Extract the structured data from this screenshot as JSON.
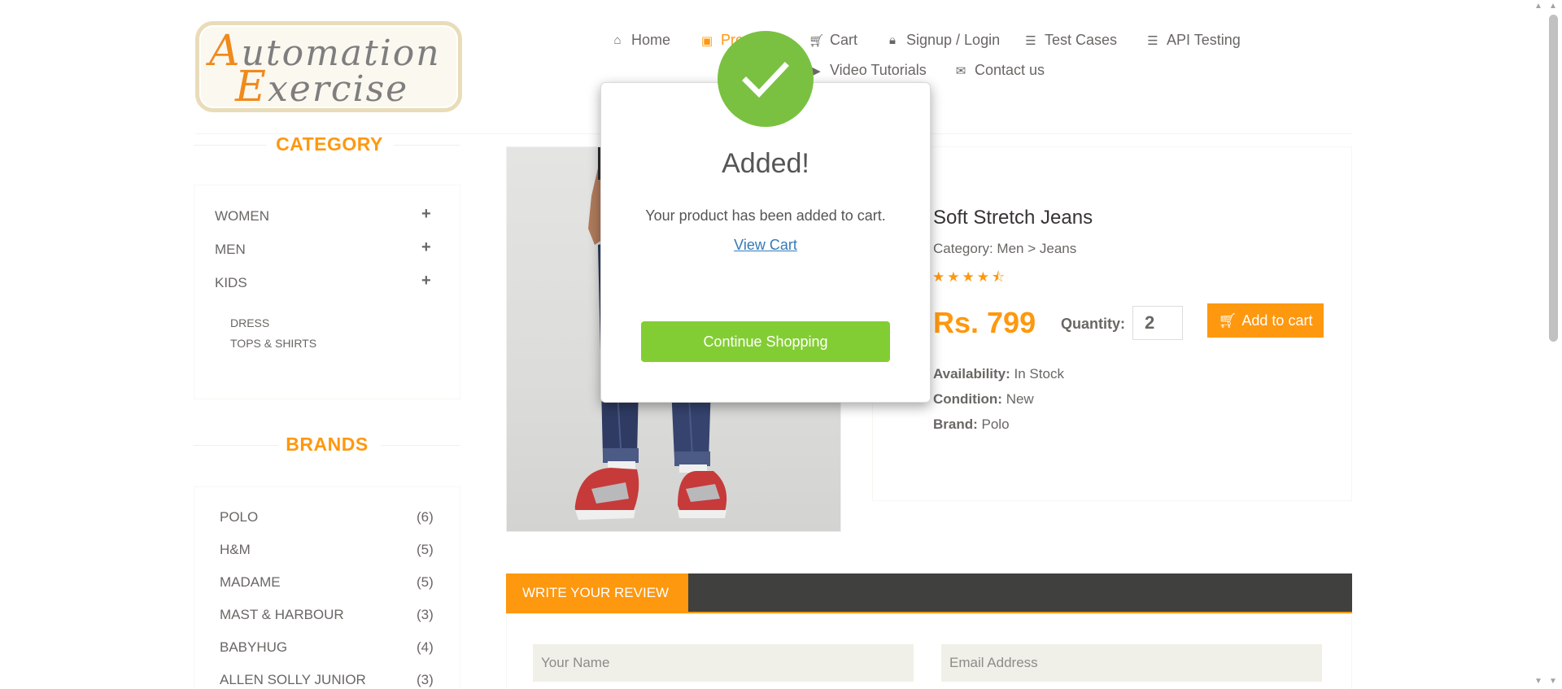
{
  "logo": {
    "line1_cap": "A",
    "line1_rest": "utomation",
    "line2_cap": "E",
    "line2_rest": "xercise"
  },
  "nav": {
    "home": "Home",
    "products": "Products",
    "cart": "Cart",
    "login": "Signup / Login",
    "test_cases": "Test Cases",
    "api_testing": "API Testing",
    "video_tutorials": "Video Tutorials",
    "contact": "Contact us"
  },
  "sidebar": {
    "category_title": "CATEGORY",
    "categories": [
      "WOMEN",
      "MEN",
      "KIDS"
    ],
    "kids_sub": [
      "DRESS",
      "TOPS & SHIRTS"
    ],
    "brands_title": "BRANDS",
    "brands": [
      {
        "name": "POLO",
        "count": "(6)"
      },
      {
        "name": "H&M",
        "count": "(5)"
      },
      {
        "name": "MADAME",
        "count": "(5)"
      },
      {
        "name": "MAST & HARBOUR",
        "count": "(3)"
      },
      {
        "name": "BABYHUG",
        "count": "(4)"
      },
      {
        "name": "ALLEN SOLLY JUNIOR",
        "count": "(3)"
      }
    ]
  },
  "product": {
    "name": "Soft Stretch Jeans",
    "category": "Category: Men > Jeans",
    "rating": 4.5,
    "price": "Rs. 799",
    "quantity_label": "Quantity:",
    "quantity": "2",
    "add_to_cart": "Add to cart",
    "availability_label": "Availability:",
    "availability": "In Stock",
    "condition_label": "Condition:",
    "condition": "New",
    "brand_label": "Brand:",
    "brand": "Polo"
  },
  "review": {
    "tab": "WRITE YOUR REVIEW",
    "name_placeholder": "Your Name",
    "email_placeholder": "Email Address"
  },
  "modal": {
    "title": "Added!",
    "message": "Your product has been added to cart.",
    "view_cart": "View Cart",
    "continue": "Continue Shopping"
  },
  "colors": {
    "accent": "#fe980f",
    "success": "#7ac142",
    "button_green": "#83cd34",
    "link": "#337ab7",
    "dark_bar": "#40403e"
  }
}
